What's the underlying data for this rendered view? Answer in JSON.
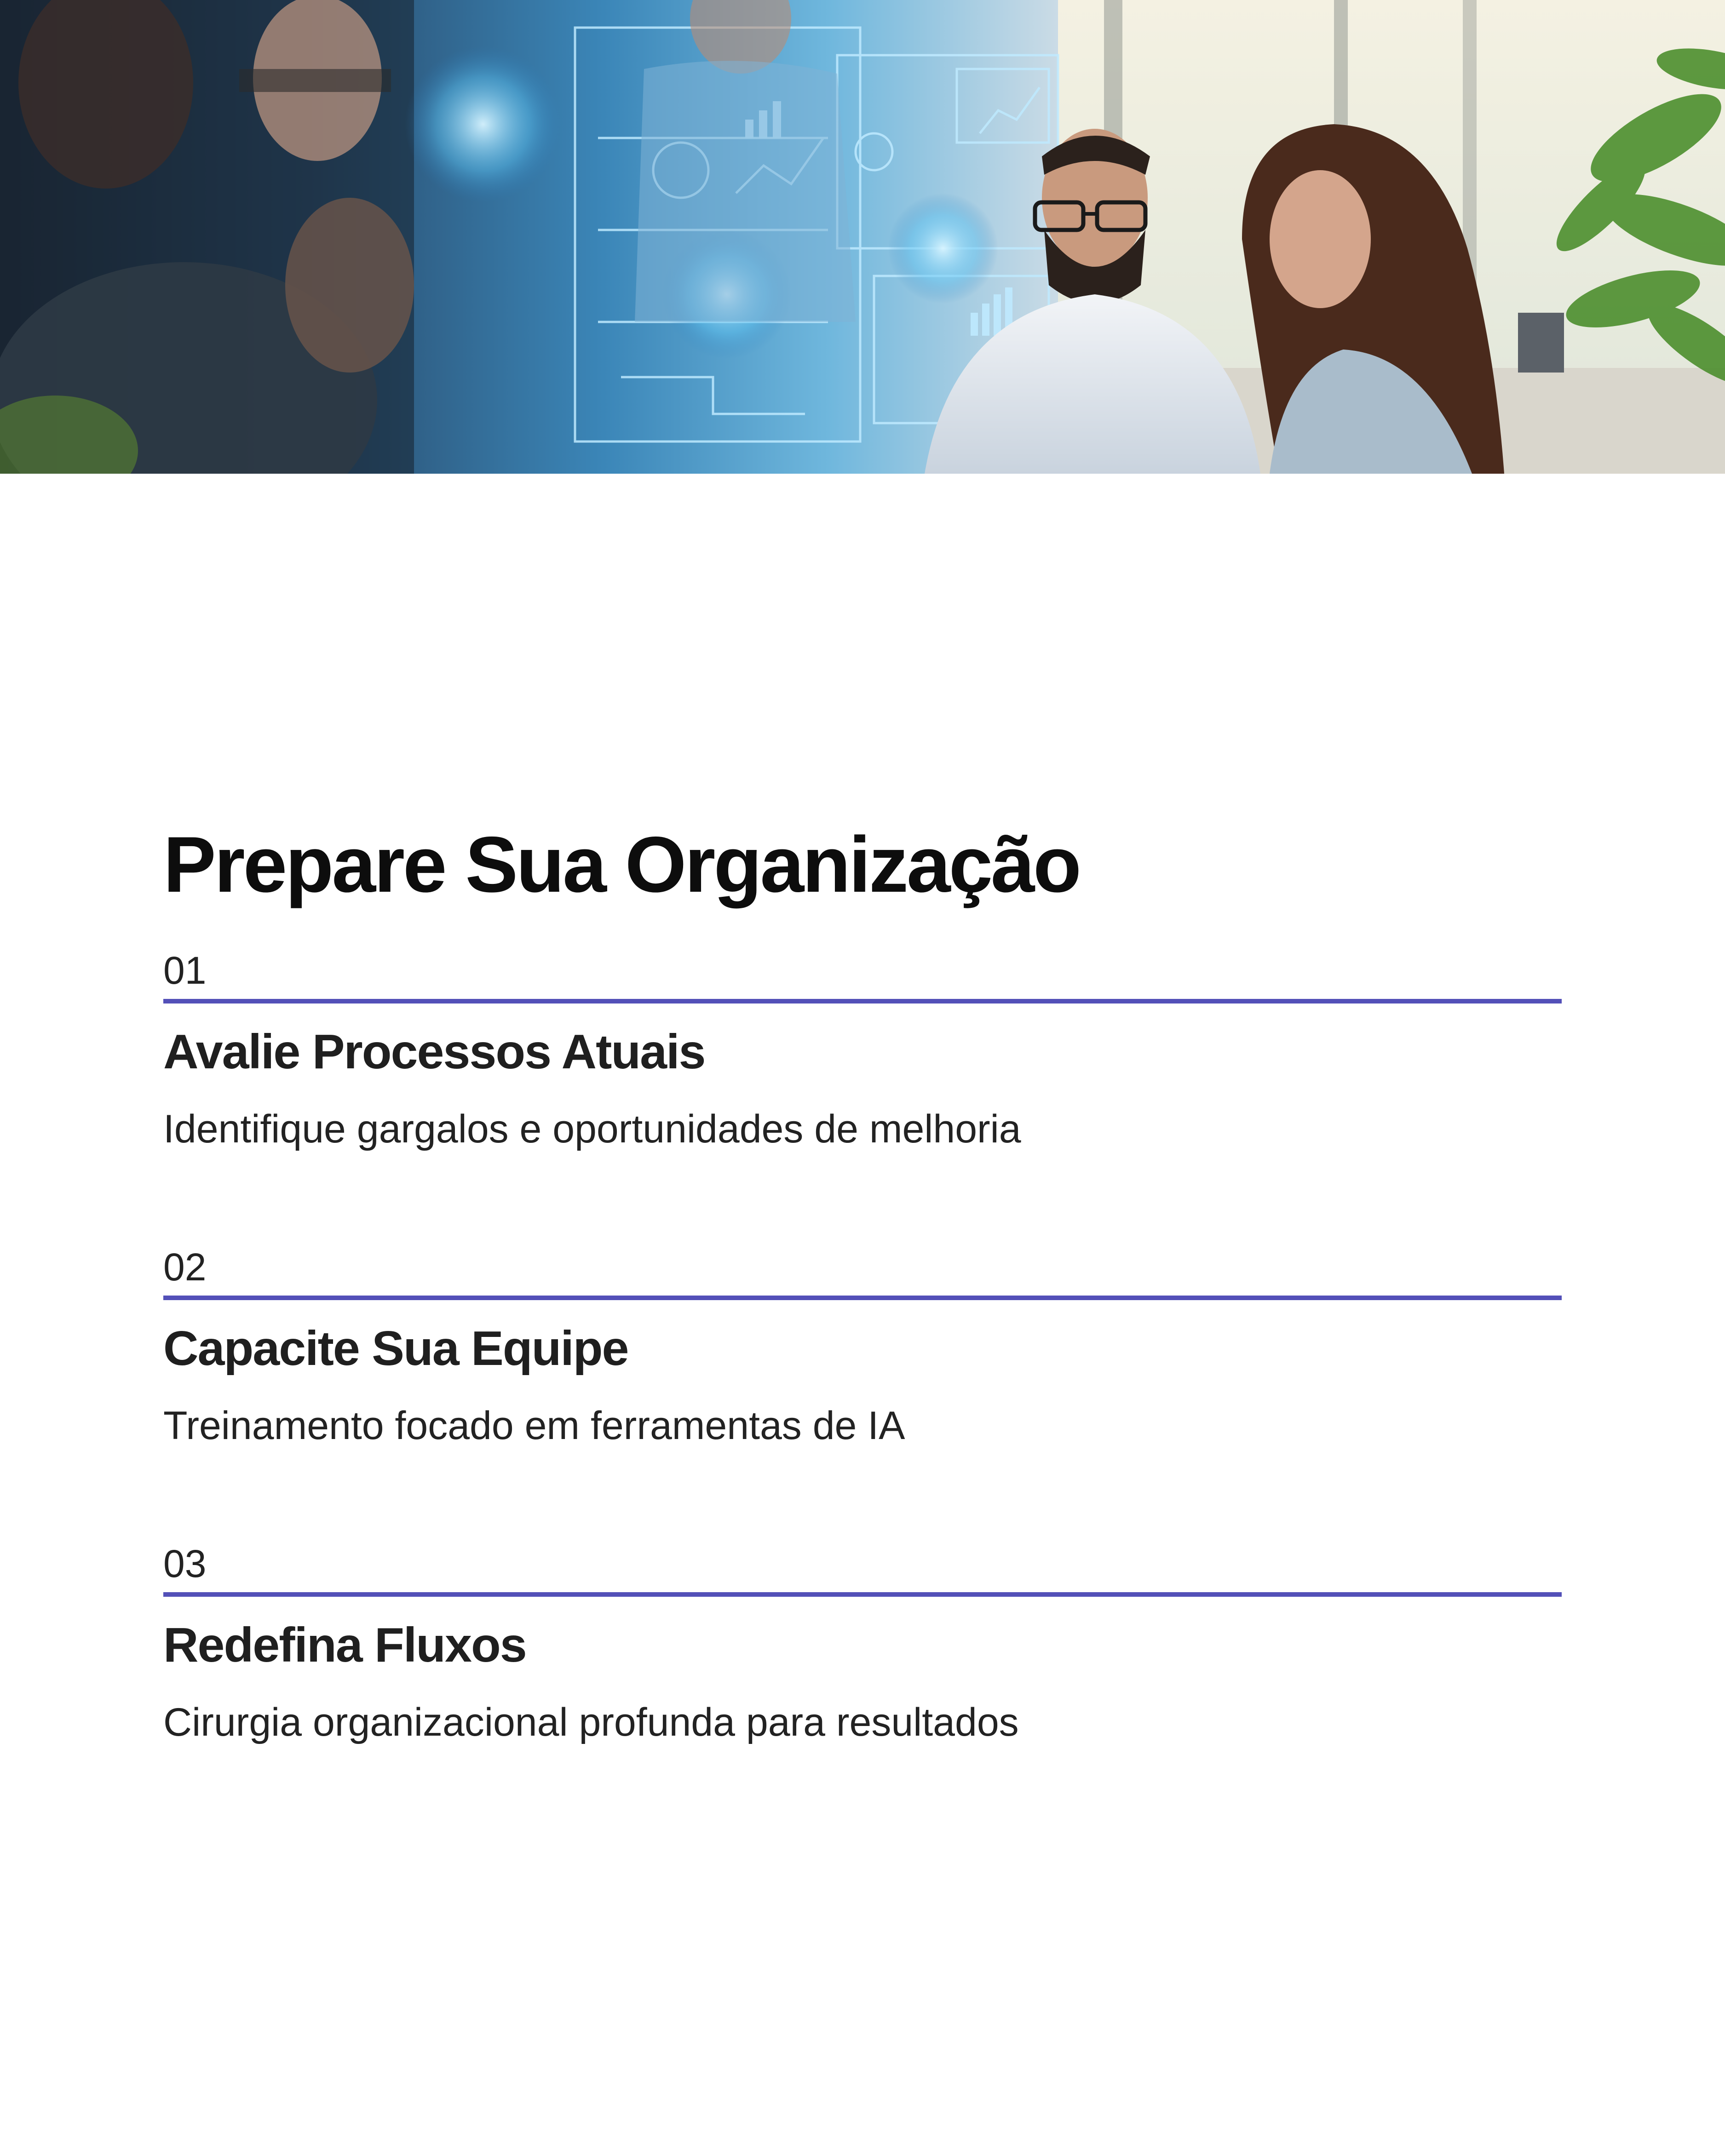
{
  "hero": {
    "image_description_name": "team-meeting-hologram-photo"
  },
  "title": "Prepare Sua Organização",
  "accent_color": "#5350b8",
  "steps": [
    {
      "number": "01",
      "title": "Avalie Processos Atuais",
      "description": "Identifique gargalos e oportunidades de melhoria"
    },
    {
      "number": "02",
      "title": "Capacite Sua Equipe",
      "description": "Treinamento focado em ferramentas de IA"
    },
    {
      "number": "03",
      "title": "Redefina Fluxos",
      "description": "Cirurgia organizacional profunda para resultados"
    }
  ]
}
